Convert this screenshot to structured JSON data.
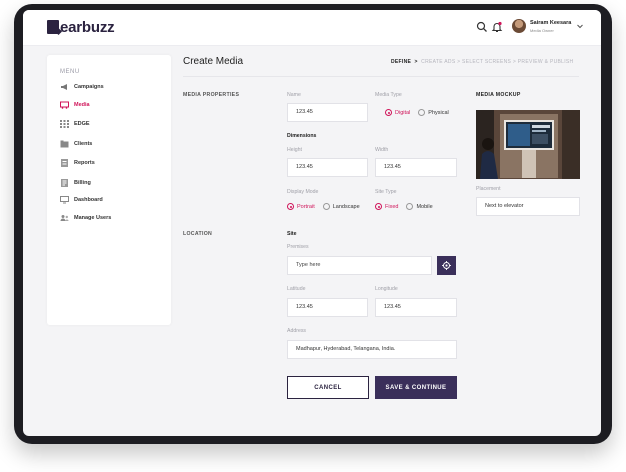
{
  "app": {
    "brand": "earbuzz"
  },
  "header": {
    "user_name": "Sairam Keesara",
    "user_role": "Media Owner"
  },
  "sidebar": {
    "title": "MENU",
    "items": [
      {
        "label": "Campaigns",
        "icon": "megaphone-icon"
      },
      {
        "label": "Media",
        "icon": "display-icon",
        "active": true
      },
      {
        "label": "EDGE",
        "icon": "grid-icon"
      },
      {
        "label": "Clients",
        "icon": "clients-icon"
      },
      {
        "label": "Reports",
        "icon": "report-icon"
      },
      {
        "label": "Billing",
        "icon": "billing-icon"
      },
      {
        "label": "Dashboard",
        "icon": "monitor-icon"
      },
      {
        "label": "Manage Users",
        "icon": "users-icon"
      }
    ]
  },
  "page": {
    "title": "Create Media",
    "steps": {
      "current": "DEFINE",
      "rest": "CREATE ADS  >  SELECT SCREENS  >  PREVIEW & PUBLISH"
    }
  },
  "media_properties": {
    "section_label": "MEDIA PROPERTIES",
    "name_label": "Name",
    "name_value": "123.45",
    "media_type_label": "Media Type",
    "media_type_options": [
      "Digital",
      "Physical"
    ],
    "dimensions_label": "Dimensions",
    "height_label": "Height",
    "height_value": "123.45",
    "width_label": "Width",
    "width_value": "123.45",
    "display_mode_label": "Display Mode",
    "display_mode_options": [
      "Portrait",
      "Landscape"
    ],
    "site_type_label": "Site Type",
    "site_type_options": [
      "Fixed",
      "Mobile"
    ]
  },
  "mockup": {
    "title": "MEDIA MOCKUP",
    "placement_label": "Placement",
    "placement_value": "Next to elevator"
  },
  "location": {
    "section_label": "LOCATION",
    "site_label": "Site",
    "premises_label": "Premises",
    "premises_placeholder": "Type here",
    "latitude_label": "Latitude",
    "latitude_value": "123.45",
    "longitude_label": "Longitude",
    "longitude_value": "123.45",
    "address_label": "Address",
    "address_value": "Madhapur, Hyderabad, Telangana, India."
  },
  "actions": {
    "cancel_label": "CANCEL",
    "save_label": "SAVE & CONTINUE"
  },
  "colors": {
    "brand": "#2b2340",
    "accent": "#d0155a",
    "primary_button": "#3a2f5a"
  }
}
